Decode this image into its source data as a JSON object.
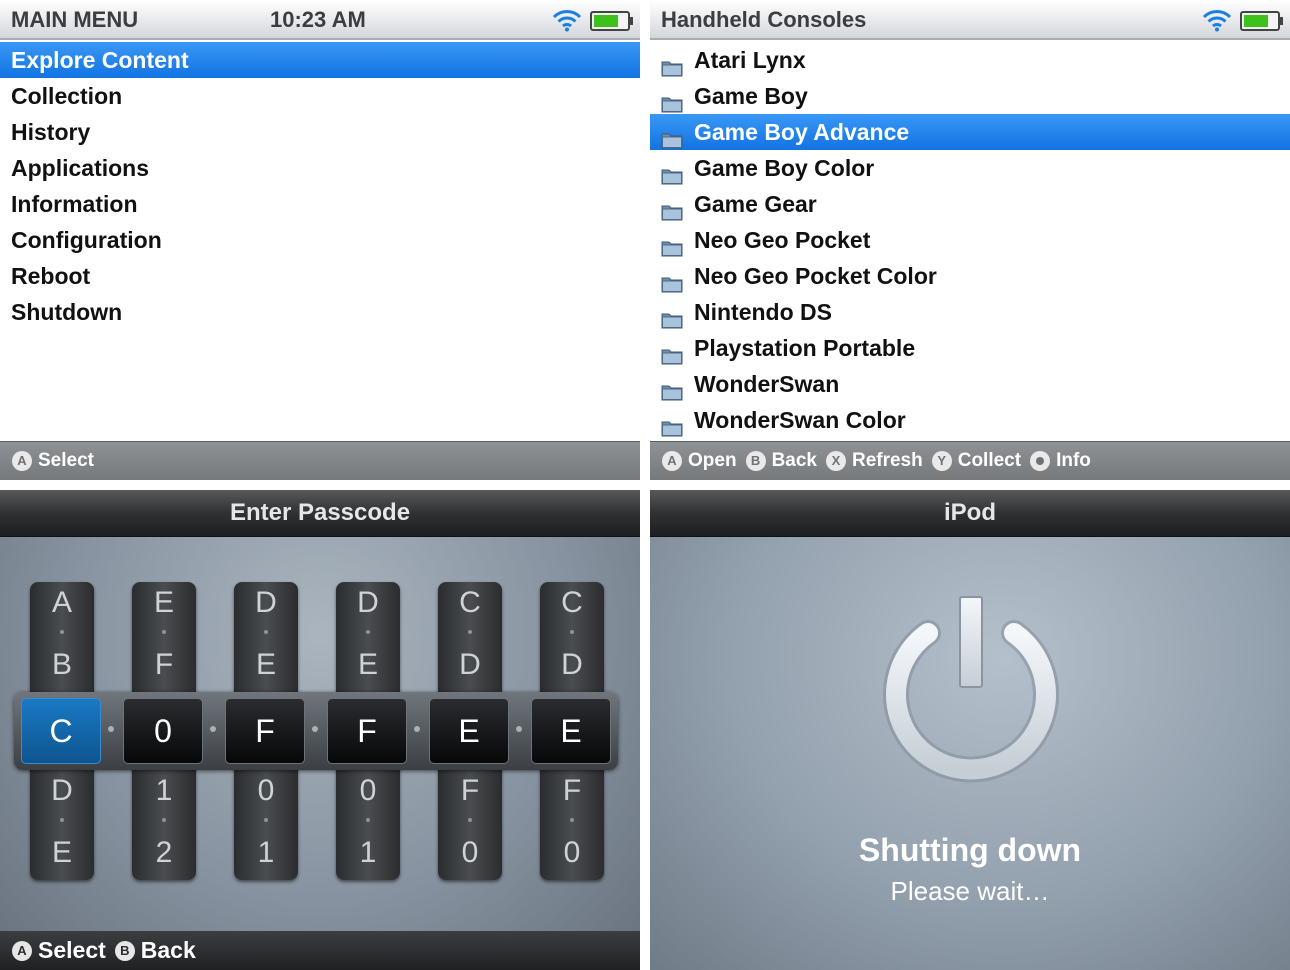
{
  "main_menu": {
    "title": "MAIN MENU",
    "time": "10:23 AM",
    "items": [
      "Explore Content",
      "Collection",
      "History",
      "Applications",
      "Information",
      "Configuration",
      "Reboot",
      "Shutdown"
    ],
    "selected_index": 0,
    "footer": {
      "a_glyph": "A",
      "a_label": "Select"
    }
  },
  "consoles": {
    "title": "Handheld Consoles",
    "items": [
      "Atari Lynx",
      "Game Boy",
      "Game Boy Advance",
      "Game Boy Color",
      "Game Gear",
      "Neo Geo Pocket",
      "Neo Geo Pocket Color",
      "Nintendo DS",
      "Playstation Portable",
      "WonderSwan",
      "WonderSwan Color"
    ],
    "selected_index": 2,
    "footer": {
      "open_glyph": "A",
      "open_label": "Open",
      "back_glyph": "B",
      "back_label": "Back",
      "refresh_glyph": "X",
      "refresh_label": "Refresh",
      "collect_glyph": "Y",
      "collect_label": "Collect",
      "info_label": "Info"
    }
  },
  "passcode": {
    "title": "Enter Passcode",
    "columns": [
      {
        "above": [
          "A",
          "B"
        ],
        "value": "C",
        "below": [
          "D",
          "E"
        ]
      },
      {
        "above": [
          "E",
          "F"
        ],
        "value": "0",
        "below": [
          "1",
          "2"
        ]
      },
      {
        "above": [
          "D",
          "E"
        ],
        "value": "F",
        "below": [
          "0",
          "1"
        ]
      },
      {
        "above": [
          "D",
          "E"
        ],
        "value": "F",
        "below": [
          "0",
          "1"
        ]
      },
      {
        "above": [
          "C",
          "D"
        ],
        "value": "E",
        "below": [
          "F",
          "0"
        ]
      },
      {
        "above": [
          "C",
          "D"
        ],
        "value": "E",
        "below": [
          "F",
          "0"
        ]
      }
    ],
    "active_index": 0,
    "footer": {
      "a_glyph": "A",
      "a_label": "Select",
      "b_glyph": "B",
      "b_label": "Back"
    }
  },
  "ipod": {
    "title": "iPod",
    "status": "Shutting down",
    "message": "Please wait…"
  },
  "colors": {
    "selection": "#1274e3",
    "battery_fill": "#3cc21a",
    "wifi": "#1a7fe0",
    "passcode_active": "#0d5590"
  }
}
